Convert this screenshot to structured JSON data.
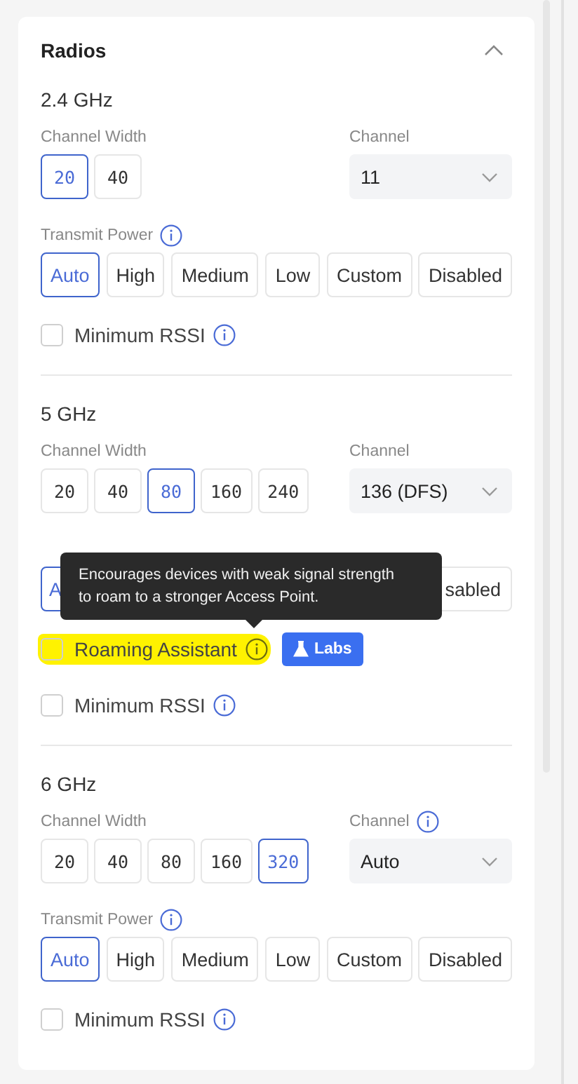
{
  "panel": {
    "title": "Radios",
    "expanded": true
  },
  "bands": [
    {
      "title": "2.4 GHz",
      "channel_width": {
        "label": "Channel Width",
        "options": [
          {
            "label": "20",
            "selected": true
          },
          {
            "label": "40",
            "selected": false
          }
        ]
      },
      "channel": {
        "label": "Channel",
        "value": "11",
        "info": false
      },
      "transmit_power": {
        "kind": "full",
        "label": "Transmit Power",
        "info": true,
        "options": [
          {
            "label": "Auto",
            "selected": true
          },
          {
            "label": "High",
            "selected": false
          },
          {
            "label": "Medium",
            "selected": false
          },
          {
            "label": "Low",
            "selected": false
          },
          {
            "label": "Custom",
            "selected": false
          },
          {
            "label": "Disabled",
            "selected": false
          }
        ]
      },
      "checkboxes": [
        {
          "label": "Minimum RSSI",
          "checked": false,
          "info": true,
          "highlighted": false
        }
      ]
    },
    {
      "title": "5 GHz",
      "channel_width": {
        "label": "Channel Width",
        "options": [
          {
            "label": "20",
            "selected": false
          },
          {
            "label": "40",
            "selected": false
          },
          {
            "label": "80",
            "selected": true
          },
          {
            "label": "160",
            "selected": false
          },
          {
            "label": "240",
            "selected": false
          }
        ]
      },
      "channel": {
        "label": "Channel",
        "value": "136 (DFS)",
        "info": false
      },
      "transmit_power": {
        "kind": "covered",
        "options": [
          {
            "label": "A",
            "selected": true
          },
          {
            "label": "sabled",
            "selected": false
          }
        ]
      },
      "checkboxes": [
        {
          "label": "Roaming Assistant",
          "checked": false,
          "info": true,
          "highlighted": true,
          "badge": "Labs",
          "tooltip": "Encourages devices with weak signal strength to roam to a stronger Access Point."
        },
        {
          "label": "Minimum RSSI",
          "checked": false,
          "info": true,
          "highlighted": false
        }
      ]
    },
    {
      "title": "6 GHz",
      "channel_width": {
        "label": "Channel Width",
        "options": [
          {
            "label": "20",
            "selected": false
          },
          {
            "label": "40",
            "selected": false
          },
          {
            "label": "80",
            "selected": false
          },
          {
            "label": "160",
            "selected": false
          },
          {
            "label": "320",
            "selected": true
          }
        ]
      },
      "channel": {
        "label": "Channel",
        "value": "Auto",
        "info": true
      },
      "transmit_power": {
        "kind": "full",
        "label": "Transmit Power",
        "info": true,
        "options": [
          {
            "label": "Auto",
            "selected": true
          },
          {
            "label": "High",
            "selected": false
          },
          {
            "label": "Medium",
            "selected": false
          },
          {
            "label": "Low",
            "selected": false
          },
          {
            "label": "Custom",
            "selected": false
          },
          {
            "label": "Disabled",
            "selected": false
          }
        ]
      },
      "checkboxes": [
        {
          "label": "Minimum RSSI",
          "checked": false,
          "info": true,
          "highlighted": false
        }
      ]
    }
  ]
}
